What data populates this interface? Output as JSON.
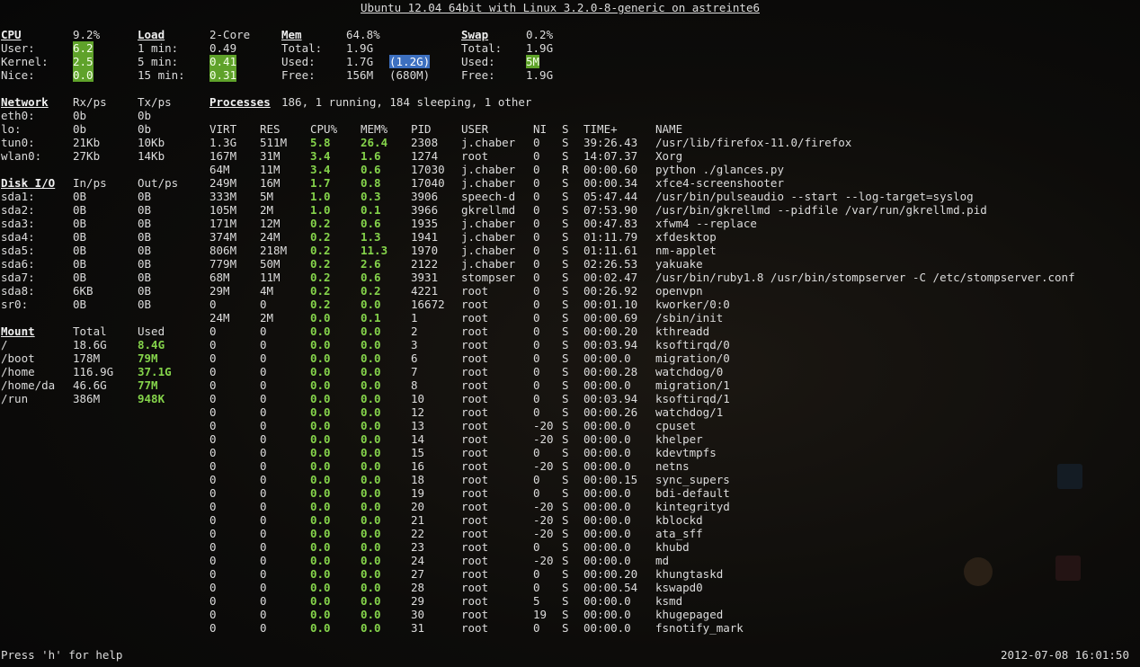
{
  "title": "Ubuntu 12.04 64bit with Linux 3.2.0-8-generic on astreinte6",
  "cpu": {
    "header": "CPU",
    "pct": "9.2%",
    "rows": [
      {
        "label": "User:",
        "value": "6.2"
      },
      {
        "label": "Kernel:",
        "value": "2.5"
      },
      {
        "label": "Nice:",
        "value": "0.0"
      }
    ]
  },
  "load": {
    "header": "Load",
    "cores": "2-Core",
    "rows": [
      {
        "label": "1 min:",
        "value": "0.49"
      },
      {
        "label": "5 min:",
        "value": "0.41"
      },
      {
        "label": "15 min:",
        "value": "0.31"
      }
    ]
  },
  "mem": {
    "header": "Mem",
    "pct": "64.8%",
    "rows": [
      {
        "label": "Total:",
        "value": "1.9G",
        "extra": ""
      },
      {
        "label": "Used:",
        "value": "1.7G",
        "extra": "(1.2G)"
      },
      {
        "label": "Free:",
        "value": "156M",
        "extra": "(680M)"
      }
    ]
  },
  "swap": {
    "header": "Swap",
    "pct": "0.2%",
    "rows": [
      {
        "label": "Total:",
        "value": "1.9G"
      },
      {
        "label": "Used:",
        "value": "5M"
      },
      {
        "label": "Free:",
        "value": "1.9G"
      }
    ]
  },
  "network": {
    "header": "Network",
    "rx_header": "Rx/ps",
    "tx_header": "Tx/ps",
    "rows": [
      {
        "iface": "eth0:",
        "rx": "0b",
        "tx": "0b"
      },
      {
        "iface": "lo:",
        "rx": "0b",
        "tx": "0b"
      },
      {
        "iface": "tun0:",
        "rx": "21Kb",
        "tx": "10Kb"
      },
      {
        "iface": "wlan0:",
        "rx": "27Kb",
        "tx": "14Kb"
      }
    ]
  },
  "disk": {
    "header": "Disk I/O",
    "in_header": "In/ps",
    "out_header": "Out/ps",
    "rows": [
      {
        "dev": "sda1:",
        "in": "0B",
        "out": "0B"
      },
      {
        "dev": "sda2:",
        "in": "0B",
        "out": "0B"
      },
      {
        "dev": "sda3:",
        "in": "0B",
        "out": "0B"
      },
      {
        "dev": "sda4:",
        "in": "0B",
        "out": "0B"
      },
      {
        "dev": "sda5:",
        "in": "0B",
        "out": "0B"
      },
      {
        "dev": "sda6:",
        "in": "0B",
        "out": "0B"
      },
      {
        "dev": "sda7:",
        "in": "0B",
        "out": "0B"
      },
      {
        "dev": "sda8:",
        "in": "6KB",
        "out": "0B"
      },
      {
        "dev": "sr0:",
        "in": "0B",
        "out": "0B"
      }
    ]
  },
  "mount": {
    "header": "Mount",
    "total_header": "Total",
    "used_header": "Used",
    "rows": [
      {
        "path": "/",
        "total": "18.6G",
        "used": "8.4G"
      },
      {
        "path": "/boot",
        "total": "178M",
        "used": "79M"
      },
      {
        "path": "/home",
        "total": "116.9G",
        "used": "37.1G"
      },
      {
        "path": "/home/da",
        "total": "46.6G",
        "used": "77M"
      },
      {
        "path": "/run",
        "total": "386M",
        "used": "948K"
      }
    ]
  },
  "processes": {
    "header": "Processes",
    "summary": "186, 1 running, 184 sleeping, 1 other",
    "columns": [
      "VIRT",
      "RES",
      "CPU%",
      "MEM%",
      "PID",
      "USER",
      "NI",
      "S",
      "TIME+",
      "NAME"
    ],
    "rows": [
      [
        "1.3G",
        "511M",
        "5.8",
        "26.4",
        "2308",
        "j.chaber",
        "0",
        "S",
        "39:26.43",
        "/usr/lib/firefox-11.0/firefox"
      ],
      [
        "167M",
        "31M",
        "3.4",
        "1.6",
        "1274",
        "root",
        "0",
        "S",
        "14:07.37",
        "Xorg"
      ],
      [
        "64M",
        "11M",
        "3.4",
        "0.6",
        "17030",
        "j.chaber",
        "0",
        "R",
        "00:00.60",
        "python ./glances.py"
      ],
      [
        "249M",
        "16M",
        "1.7",
        "0.8",
        "17040",
        "j.chaber",
        "0",
        "S",
        "00:00.34",
        "xfce4-screenshooter"
      ],
      [
        "333M",
        "5M",
        "1.0",
        "0.3",
        "3906",
        "speech-d",
        "0",
        "S",
        "05:47.44",
        "/usr/bin/pulseaudio --start --log-target=syslog"
      ],
      [
        "105M",
        "2M",
        "1.0",
        "0.1",
        "3966",
        "gkrellmd",
        "0",
        "S",
        "07:53.90",
        "/usr/bin/gkrellmd --pidfile /var/run/gkrellmd.pid"
      ],
      [
        "171M",
        "12M",
        "0.2",
        "0.6",
        "1935",
        "j.chaber",
        "0",
        "S",
        "00:47.83",
        "xfwm4 --replace"
      ],
      [
        "374M",
        "24M",
        "0.2",
        "1.3",
        "1941",
        "j.chaber",
        "0",
        "S",
        "01:11.79",
        "xfdesktop"
      ],
      [
        "806M",
        "218M",
        "0.2",
        "11.3",
        "1970",
        "j.chaber",
        "0",
        "S",
        "01:11.61",
        "nm-applet"
      ],
      [
        "779M",
        "50M",
        "0.2",
        "2.6",
        "2122",
        "j.chaber",
        "0",
        "S",
        "02:26.53",
        "yakuake"
      ],
      [
        "68M",
        "11M",
        "0.2",
        "0.6",
        "3931",
        "stompser",
        "0",
        "S",
        "00:02.47",
        "/usr/bin/ruby1.8 /usr/bin/stompserver -C /etc/stompserver.conf"
      ],
      [
        "29M",
        "4M",
        "0.2",
        "0.2",
        "4221",
        "root",
        "0",
        "S",
        "00:26.92",
        "openvpn"
      ],
      [
        "0",
        "0",
        "0.2",
        "0.0",
        "16672",
        "root",
        "0",
        "S",
        "00:01.10",
        "kworker/0:0"
      ],
      [
        "24M",
        "2M",
        "0.0",
        "0.1",
        "1",
        "root",
        "0",
        "S",
        "00:00.69",
        "/sbin/init"
      ],
      [
        "0",
        "0",
        "0.0",
        "0.0",
        "2",
        "root",
        "0",
        "S",
        "00:00.20",
        "kthreadd"
      ],
      [
        "0",
        "0",
        "0.0",
        "0.0",
        "3",
        "root",
        "0",
        "S",
        "00:03.94",
        "ksoftirqd/0"
      ],
      [
        "0",
        "0",
        "0.0",
        "0.0",
        "6",
        "root",
        "0",
        "S",
        "00:00.0",
        "migration/0"
      ],
      [
        "0",
        "0",
        "0.0",
        "0.0",
        "7",
        "root",
        "0",
        "S",
        "00:00.28",
        "watchdog/0"
      ],
      [
        "0",
        "0",
        "0.0",
        "0.0",
        "8",
        "root",
        "0",
        "S",
        "00:00.0",
        "migration/1"
      ],
      [
        "0",
        "0",
        "0.0",
        "0.0",
        "10",
        "root",
        "0",
        "S",
        "00:03.94",
        "ksoftirqd/1"
      ],
      [
        "0",
        "0",
        "0.0",
        "0.0",
        "12",
        "root",
        "0",
        "S",
        "00:00.26",
        "watchdog/1"
      ],
      [
        "0",
        "0",
        "0.0",
        "0.0",
        "13",
        "root",
        "-20",
        "S",
        "00:00.0",
        "cpuset"
      ],
      [
        "0",
        "0",
        "0.0",
        "0.0",
        "14",
        "root",
        "-20",
        "S",
        "00:00.0",
        "khelper"
      ],
      [
        "0",
        "0",
        "0.0",
        "0.0",
        "15",
        "root",
        "0",
        "S",
        "00:00.0",
        "kdevtmpfs"
      ],
      [
        "0",
        "0",
        "0.0",
        "0.0",
        "16",
        "root",
        "-20",
        "S",
        "00:00.0",
        "netns"
      ],
      [
        "0",
        "0",
        "0.0",
        "0.0",
        "18",
        "root",
        "0",
        "S",
        "00:00.15",
        "sync_supers"
      ],
      [
        "0",
        "0",
        "0.0",
        "0.0",
        "19",
        "root",
        "0",
        "S",
        "00:00.0",
        "bdi-default"
      ],
      [
        "0",
        "0",
        "0.0",
        "0.0",
        "20",
        "root",
        "-20",
        "S",
        "00:00.0",
        "kintegrityd"
      ],
      [
        "0",
        "0",
        "0.0",
        "0.0",
        "21",
        "root",
        "-20",
        "S",
        "00:00.0",
        "kblockd"
      ],
      [
        "0",
        "0",
        "0.0",
        "0.0",
        "22",
        "root",
        "-20",
        "S",
        "00:00.0",
        "ata_sff"
      ],
      [
        "0",
        "0",
        "0.0",
        "0.0",
        "23",
        "root",
        "0",
        "S",
        "00:00.0",
        "khubd"
      ],
      [
        "0",
        "0",
        "0.0",
        "0.0",
        "24",
        "root",
        "-20",
        "S",
        "00:00.0",
        "md"
      ],
      [
        "0",
        "0",
        "0.0",
        "0.0",
        "27",
        "root",
        "0",
        "S",
        "00:00.20",
        "khungtaskd"
      ],
      [
        "0",
        "0",
        "0.0",
        "0.0",
        "28",
        "root",
        "0",
        "S",
        "00:00.54",
        "kswapd0"
      ],
      [
        "0",
        "0",
        "0.0",
        "0.0",
        "29",
        "root",
        "5",
        "S",
        "00:00.0",
        "ksmd"
      ],
      [
        "0",
        "0",
        "0.0",
        "0.0",
        "30",
        "root",
        "19",
        "S",
        "00:00.0",
        "khugepaged"
      ],
      [
        "0",
        "0",
        "0.0",
        "0.0",
        "31",
        "root",
        "0",
        "S",
        "00:00.0",
        "fsnotify_mark"
      ]
    ]
  },
  "footer": {
    "help": "Press 'h' for help",
    "datetime": "2012-07-08 16:01:50"
  },
  "colors": {
    "highlight_green": "#5fa22a",
    "text_green": "#85d44b",
    "highlight_blue": "#3d70c0",
    "foreground": "#dcdcdc",
    "background": "#0c0c0c"
  }
}
